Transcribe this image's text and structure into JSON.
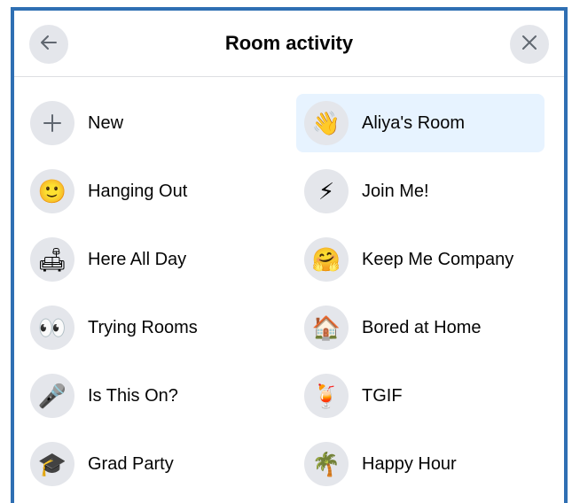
{
  "header": {
    "title": "Room activity",
    "back_icon": "arrow-left-icon",
    "close_icon": "close-icon"
  },
  "colors": {
    "frame_border": "#2f6fb3",
    "selected_bg": "#e7f3ff",
    "icon_bg": "#e4e6eb"
  },
  "activities": {
    "left": [
      {
        "label": "New",
        "icon": "plus-icon",
        "glyph": ""
      },
      {
        "label": "Hanging Out",
        "icon": "smiley-face-icon",
        "glyph": "🙂"
      },
      {
        "label": "Here All Day",
        "icon": "couch-icon",
        "glyph": "🛋"
      },
      {
        "label": "Trying Rooms",
        "icon": "eyes-icon",
        "glyph": "👀"
      },
      {
        "label": "Is This On?",
        "icon": "microphone-icon",
        "glyph": "🎤"
      },
      {
        "label": "Grad Party",
        "icon": "graduation-cap-icon",
        "glyph": "🎓"
      }
    ],
    "right": [
      {
        "label": "Aliya's Room",
        "icon": "waving-hand-icon",
        "glyph": "👋",
        "selected": true
      },
      {
        "label": "Join Me!",
        "icon": "lightning-icon",
        "glyph": "⚡"
      },
      {
        "label": "Keep Me Company",
        "icon": "hugging-face-icon",
        "glyph": "🤗"
      },
      {
        "label": "Bored at Home",
        "icon": "house-icon",
        "glyph": "🏠"
      },
      {
        "label": "TGIF",
        "icon": "tropical-drink-icon",
        "glyph": "🍹"
      },
      {
        "label": "Happy Hour",
        "icon": "palm-tree-icon",
        "glyph": "🌴"
      }
    ]
  }
}
